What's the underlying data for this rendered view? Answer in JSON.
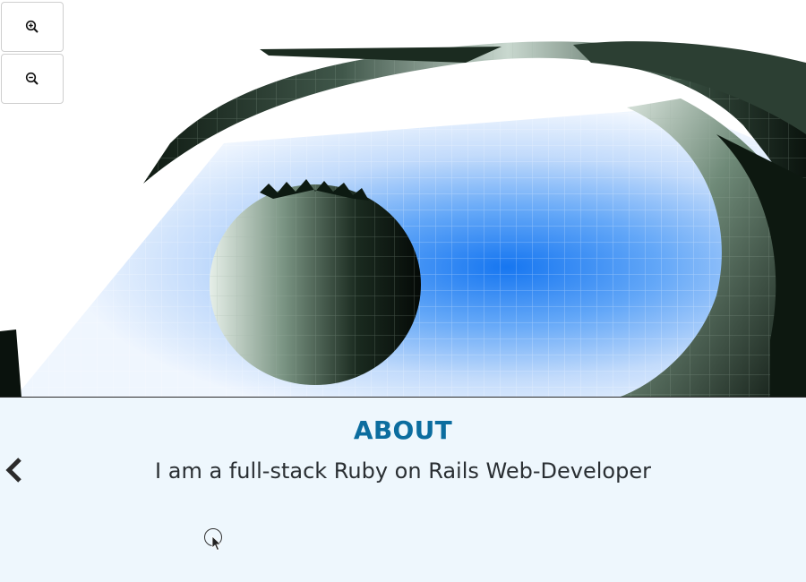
{
  "scene": {
    "zoom_in_icon": "zoom-in-icon",
    "zoom_out_icon": "zoom-out-icon",
    "colors": {
      "surface_dark": "#0f1a12",
      "surface_mid": "#5f7a68",
      "surface_light": "#dfe9e2",
      "heat_high": "#0a6ff0",
      "heat_low": "#dcebfd"
    }
  },
  "about": {
    "title": "ABOUT",
    "text": "I am a full-stack Ruby on Rails Web-Developer",
    "prev_icon": "chevron-left-icon"
  },
  "colors": {
    "accent": "#0c6d9f",
    "panel_bg": "#eef7fd",
    "text": "#2a2f33"
  }
}
